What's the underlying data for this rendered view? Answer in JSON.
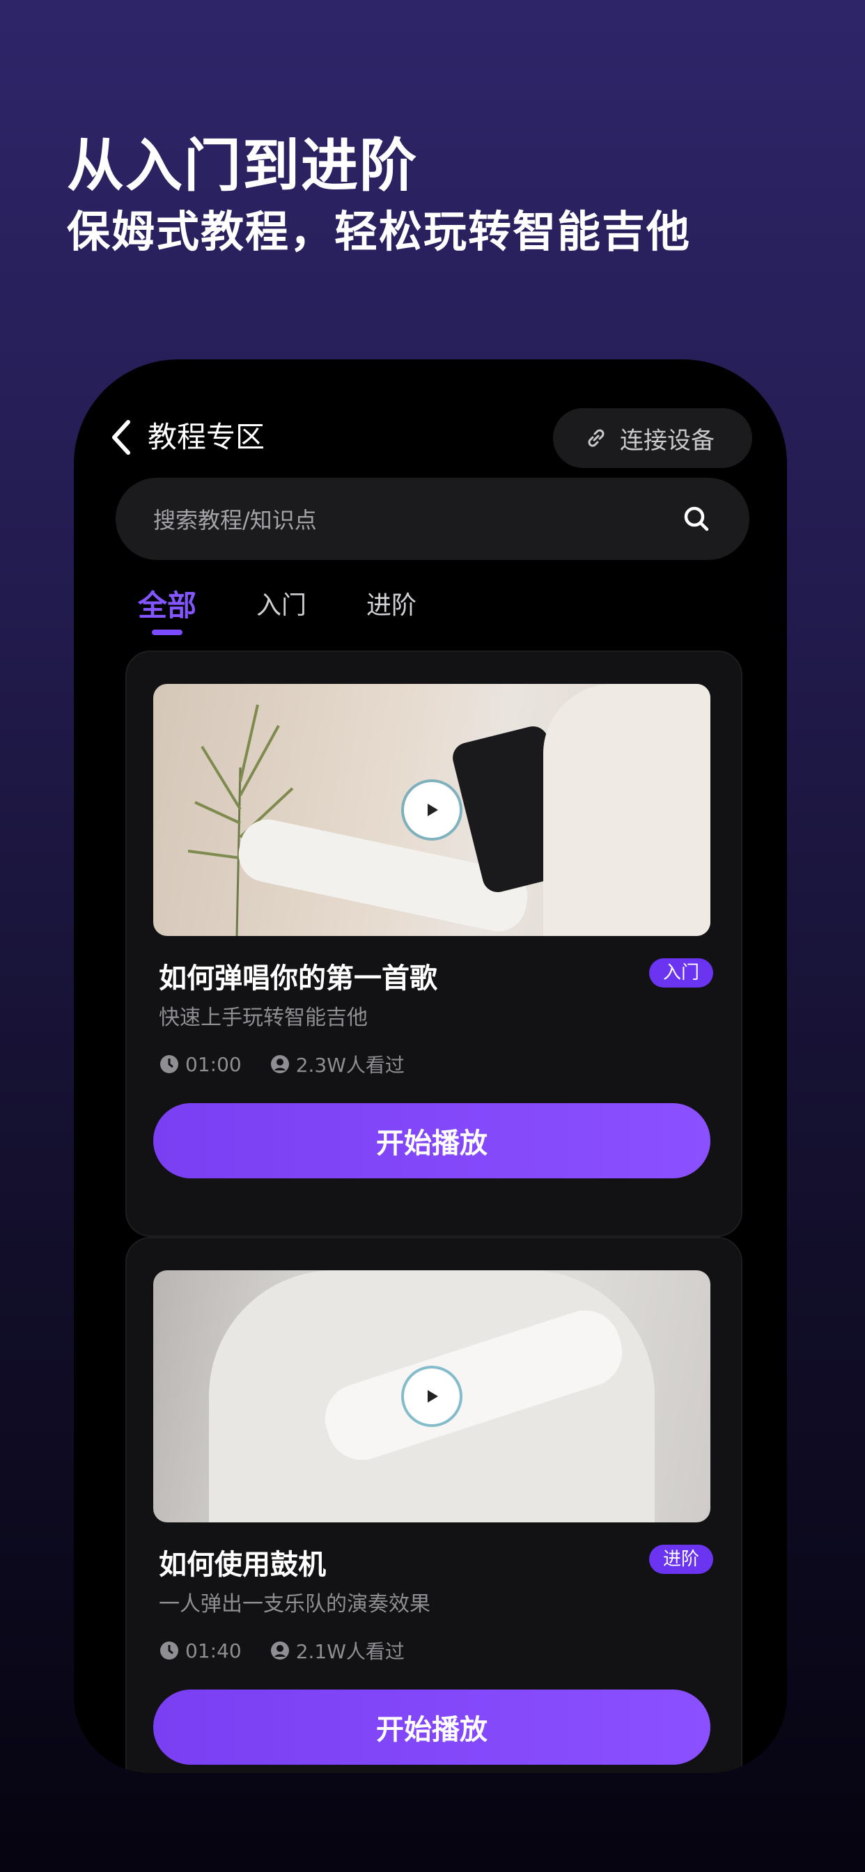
{
  "hero": {
    "title": "从入门到进阶",
    "subtitle": "保姆式教程，轻松玩转智能吉他"
  },
  "app": {
    "nav_title": "教程专区",
    "connect_label": "连接设备",
    "search_placeholder": "搜索教程/知识点",
    "tabs": [
      {
        "label": "全部",
        "active": true
      },
      {
        "label": "入门",
        "active": false
      },
      {
        "label": "进阶",
        "active": false
      }
    ],
    "accent_color": "#7b4cff",
    "cards": [
      {
        "title": "如何弹唱你的第一首歌",
        "description": "快速上手玩转智能吉他",
        "badge": "入门",
        "duration": "01:00",
        "views": "2.3W人看过",
        "cta": "开始播放"
      },
      {
        "title": "如何使用鼓机",
        "description": "一人弹出一支乐队的演奏效果",
        "badge": "进阶",
        "duration": "01:40",
        "views": "2.1W人看过",
        "cta": "开始播放"
      }
    ]
  }
}
